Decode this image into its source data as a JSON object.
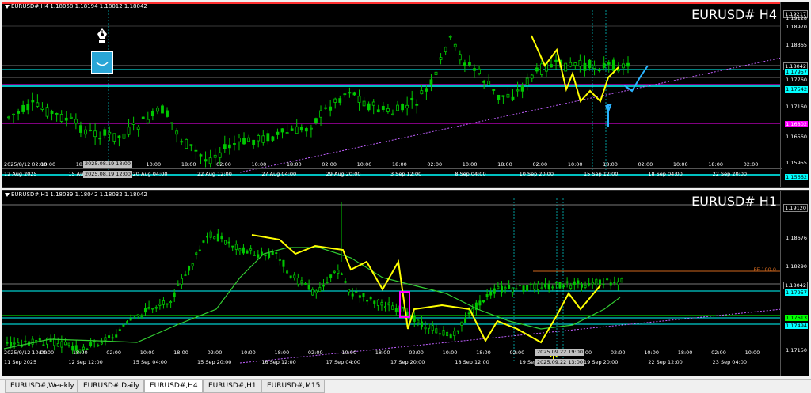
{
  "top_chart": {
    "info": "EURUSD#,H4  1.18058 1.18194 1.18012 1.18042",
    "title": "EURUSD# H4",
    "price_labels": [
      "1.19217",
      "1.19128",
      "1.18970",
      "1.18365",
      "1.18042",
      "1.17957",
      "1.17760",
      "1.17542",
      "1.17160",
      "1.16802",
      "1.16560",
      "1.15955",
      "1.15662"
    ],
    "x_labels": [
      "2025/8/12 02:00",
      "10:00",
      "18:00",
      "02:00",
      "10:00",
      "18:00",
      "02:00",
      "10:00",
      "18:00",
      "02:00",
      "10:00",
      "18:00",
      "02:00",
      "10:00",
      "18:00",
      "02:00",
      "10:00",
      "18:00",
      "02:00",
      "10:00",
      "18:00",
      "02:00"
    ],
    "x_labels_bottom": [
      "12 Aug 2025",
      "15 Aug 12:00",
      "20 Aug 04:00",
      "22 Aug 12:00",
      "27 Aug 04:00",
      "29 Aug 20:00",
      "3 Sep 12:00",
      "8 Sep 04:00",
      "10 Sep 20:00",
      "15 Sep 12:00",
      "18 Sep 04:00",
      "22 Sep 20:00"
    ],
    "time_box": "2025.08.19 18:00",
    "time_box2": "2025.08.19 12:00"
  },
  "bottom_chart": {
    "info": "EURUSD#,H1  1.18039 1.18042 1.18032 1.18042",
    "title": "EURUSD# H1",
    "price_labels": [
      "1.19120",
      "1.18676",
      "1.18290",
      "1.18042",
      "1.17957",
      "1.17613",
      "1.17494",
      "1.17150"
    ],
    "fe_label": "FE 100.0",
    "x_labels": [
      "2025/9/12 10:00",
      "10:00",
      "18:00",
      "02:00",
      "10:00",
      "18:00",
      "02:00",
      "10:00",
      "18:00",
      "02:00",
      "10:00",
      "18:00",
      "02:00",
      "10:00",
      "18:00",
      "02:00",
      "10:00",
      "18:00",
      "02:00",
      "10:00",
      "18:00",
      "02:00",
      "10:00"
    ],
    "x_labels_bottom": [
      "11 Sep 2025",
      "12 Sep 12:00",
      "15 Sep 04:00",
      "15 Sep 20:00",
      "16 Sep 12:00",
      "17 Sep 04:00",
      "17 Sep 20:00",
      "18 Sep 12:00",
      "19 Sep 04:00",
      "19 Sep 20:00",
      "22 Sep 12:00",
      "23 Sep 04:00"
    ],
    "time_box": "2025.09.22 19:00",
    "time_box2": "2025.09.22 13:00"
  },
  "tabs": [
    "EURUSD#,Weekly",
    "EURUSD#,Daily",
    "EURUSD#,H4",
    "EURUSD#,H1",
    "EURUSD#,M15"
  ],
  "active_tab": "EURUSD#,H4",
  "colors": {
    "background": "#000000",
    "candle_up": "#00c800",
    "candle_down": "#00c800",
    "cyan": "#00ffff",
    "magenta": "#ff00ff",
    "yellow": "#ffff00",
    "ma": "#32cd32",
    "fe": "#d2691e"
  },
  "icons": [
    "pen-icon",
    "smile-icon",
    "up-arrow-icon"
  ]
}
